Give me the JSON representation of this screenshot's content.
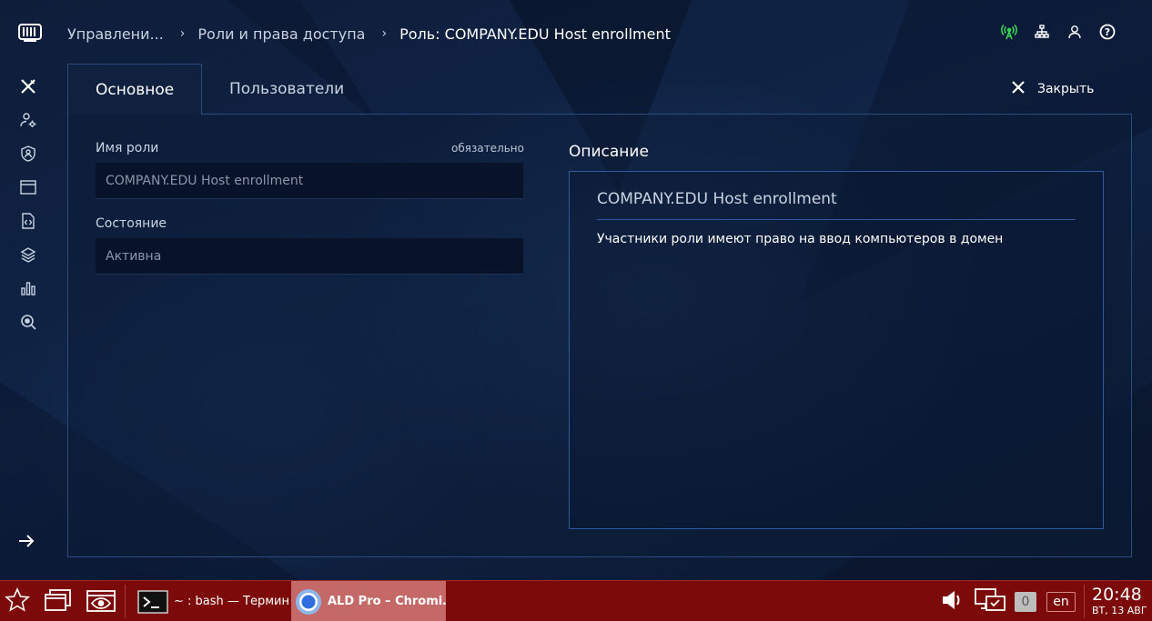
{
  "breadcrumbs": [
    "Управлени...",
    "Роли и права доступа",
    "Роль: COMPANY.EDU Host enrollment"
  ],
  "header_icons": [
    "antenna-icon",
    "network-icon",
    "user-icon",
    "help-icon"
  ],
  "rail_icons": [
    "tools-icon",
    "user-settings-icon",
    "user-shield-icon",
    "window-icon",
    "code-file-icon",
    "layers-icon",
    "bar-chart-icon",
    "search-zoom-icon"
  ],
  "tabs": [
    {
      "label": "Основное",
      "active": true
    },
    {
      "label": "Пользователи",
      "active": false
    }
  ],
  "close_label": "Закрыть",
  "form": {
    "role_name_label": "Имя роли",
    "required_label": "обязательно",
    "role_name_value": "COMPANY.EDU Host enrollment",
    "state_label": "Состояние",
    "state_value": "Активна"
  },
  "description": {
    "title": "Описание",
    "name": "COMPANY.EDU Host enrollment",
    "text": "Участники роли имеют право на ввод компьютеров в домен"
  },
  "taskbar": {
    "tasks": [
      {
        "label": "~ : bash — Термин…",
        "active": false
      },
      {
        "label": "ALD Pro – Chromi…",
        "active": true
      }
    ],
    "kbd_count": "0",
    "lang": "en",
    "time": "20:48",
    "date": "ВТ, 13 АВГ"
  },
  "colors": {
    "accent_green": "#39d353",
    "taskbar": "#7c0a0a",
    "panel_border": "#2a4a80"
  }
}
